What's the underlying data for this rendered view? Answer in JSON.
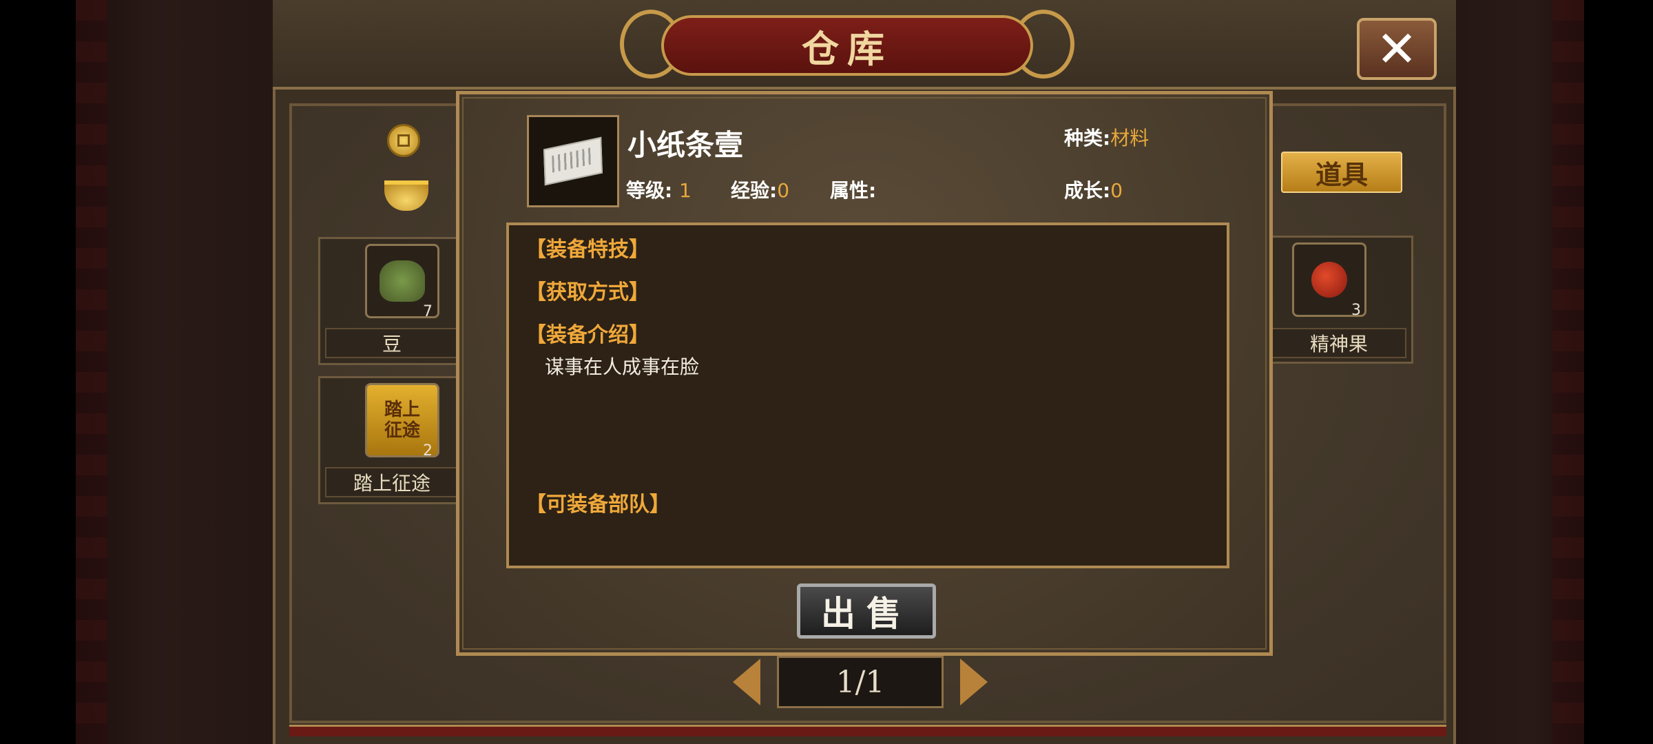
{
  "window": {
    "title": "仓库"
  },
  "tabs": {
    "items_label": "道具"
  },
  "inventory": [
    {
      "name": "豆",
      "count": "7"
    },
    {
      "name": "精神果",
      "count": "3"
    },
    {
      "name": "踏上征途",
      "count": "2",
      "icon_text": "踏上征途"
    }
  ],
  "pagination": {
    "label": "1/1"
  },
  "item_detail": {
    "name": "小纸条壹",
    "type_label": "种类:",
    "type_value": "材料",
    "level_label": "等级:",
    "level_value": "1",
    "exp_label": "经验:",
    "exp_value": "0",
    "attr_label": "属性:",
    "growth_label": "成长:",
    "growth_value": "0",
    "sections": {
      "skill": "【装备特技】",
      "source": "【获取方式】",
      "intro": "【装备介绍】",
      "units": "【可装备部队】"
    },
    "description": "谋事在人成事在脸",
    "sell_label": "出售"
  },
  "icons": {
    "close": "close-icon",
    "coin": "copper-coin-icon",
    "ingot": "gold-ingot-icon",
    "item": "paper-note-icon"
  },
  "colors": {
    "accent": "#e8a83c",
    "frame": "#b08a52",
    "title_red": "#7e1e18"
  }
}
